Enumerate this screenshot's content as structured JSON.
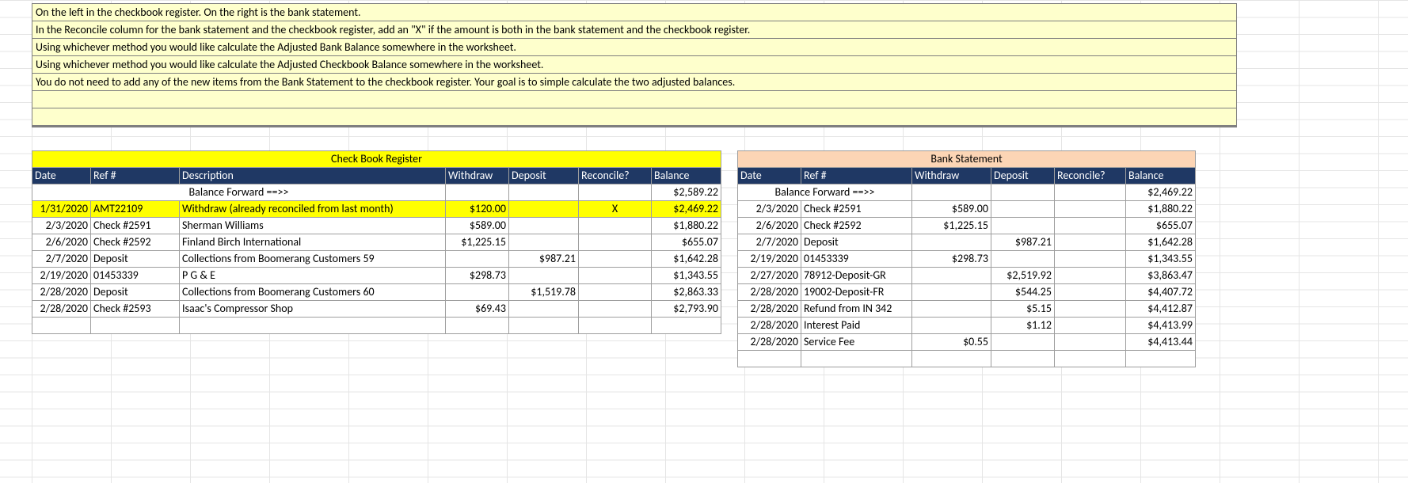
{
  "instructions": [
    "On the left in the checkbook register. On the right is the bank statement.",
    "In the Reconcile column for the bank statement and the checkbook register, add an \"X\" if the amount is both in the bank statement and the checkbook register.",
    "Using whichever method you would like calculate the Adjusted Bank Balance somewhere in the worksheet.",
    "Using whichever method you would like calculate the Adjusted Checkbook Balance somewhere in the worksheet.",
    "You do not need to add any of the new items from the Bank Statement to the checkbook register. Your goal is to simple calculate the two adjusted balances.",
    "",
    ""
  ],
  "checkbook": {
    "title": "Check Book Register",
    "headers": {
      "date": "Date",
      "ref": "Ref #",
      "desc": "Description",
      "withdraw": "Withdraw",
      "deposit": "Deposit",
      "reconcile": "Reconcile?",
      "balance": "Balance"
    },
    "balance_forward_label": "Balance Forward ==>>",
    "balance_forward": "$2,589.22",
    "rows": [
      {
        "date": "1/31/2020",
        "ref": "AMT22109",
        "desc": "Withdraw (already reconciled from last month)",
        "withdraw": "$120.00",
        "deposit": "",
        "reconcile": "X",
        "balance": "$2,469.22",
        "highlight": true
      },
      {
        "date": "2/3/2020",
        "ref": "Check #2591",
        "desc": "Sherman Williams",
        "withdraw": "$589.00",
        "deposit": "",
        "reconcile": "",
        "balance": "$1,880.22"
      },
      {
        "date": "2/6/2020",
        "ref": "Check #2592",
        "desc": "Finland Birch International",
        "withdraw": "$1,225.15",
        "deposit": "",
        "reconcile": "",
        "balance": "$655.07"
      },
      {
        "date": "2/7/2020",
        "ref": "Deposit",
        "desc": "Collections from Boomerang Customers 59",
        "withdraw": "",
        "deposit": "$987.21",
        "reconcile": "",
        "balance": "$1,642.28"
      },
      {
        "date": "2/19/2020",
        "ref": "01453339",
        "desc": "P G & E",
        "withdraw": "$298.73",
        "deposit": "",
        "reconcile": "",
        "balance": "$1,343.55"
      },
      {
        "date": "2/28/2020",
        "ref": "Deposit",
        "desc": "Collections from Boomerang Customers 60",
        "withdraw": "",
        "deposit": "$1,519.78",
        "reconcile": "",
        "balance": "$2,863.33"
      },
      {
        "date": "2/28/2020",
        "ref": "Check #2593",
        "desc": "Isaac's Compressor Shop",
        "withdraw": "$69.43",
        "deposit": "",
        "reconcile": "",
        "balance": "$2,793.90"
      },
      {
        "date": "",
        "ref": "",
        "desc": "",
        "withdraw": "",
        "deposit": "",
        "reconcile": "",
        "balance": ""
      }
    ]
  },
  "bank": {
    "title": "Bank Statement",
    "headers": {
      "date": "Date",
      "ref": "Ref #",
      "withdraw": "Withdraw",
      "deposit": "Deposit",
      "reconcile": "Reconcile?",
      "balance": "Balance"
    },
    "balance_forward_label": "Balance Forward ==>>",
    "balance_forward": "$2,469.22",
    "rows": [
      {
        "date": "2/3/2020",
        "ref": "Check #2591",
        "withdraw": "$589.00",
        "deposit": "",
        "reconcile": "",
        "balance": "$1,880.22"
      },
      {
        "date": "2/6/2020",
        "ref": "Check #2592",
        "withdraw": "$1,225.15",
        "deposit": "",
        "reconcile": "",
        "balance": "$655.07"
      },
      {
        "date": "2/7/2020",
        "ref": "Deposit",
        "withdraw": "",
        "deposit": "$987.21",
        "reconcile": "",
        "balance": "$1,642.28"
      },
      {
        "date": "2/19/2020",
        "ref": "01453339",
        "withdraw": "$298.73",
        "deposit": "",
        "reconcile": "",
        "balance": "$1,343.55"
      },
      {
        "date": "2/27/2020",
        "ref": "78912-Deposit-GR",
        "withdraw": "",
        "deposit": "$2,519.92",
        "reconcile": "",
        "balance": "$3,863.47"
      },
      {
        "date": "2/28/2020",
        "ref": "19002-Deposit-FR",
        "withdraw": "",
        "deposit": "$544.25",
        "reconcile": "",
        "balance": "$4,407.72"
      },
      {
        "date": "2/28/2020",
        "ref": "Refund from IN 342",
        "withdraw": "",
        "deposit": "$5.15",
        "reconcile": "",
        "balance": "$4,412.87"
      },
      {
        "date": "2/28/2020",
        "ref": "Interest Paid",
        "withdraw": "",
        "deposit": "$1.12",
        "reconcile": "",
        "balance": "$4,413.99"
      },
      {
        "date": "2/28/2020",
        "ref": "Service Fee",
        "withdraw": "$0.55",
        "deposit": "",
        "reconcile": "",
        "balance": "$4,413.44"
      },
      {
        "date": "",
        "ref": "",
        "withdraw": "",
        "deposit": "",
        "reconcile": "",
        "balance": ""
      }
    ]
  }
}
